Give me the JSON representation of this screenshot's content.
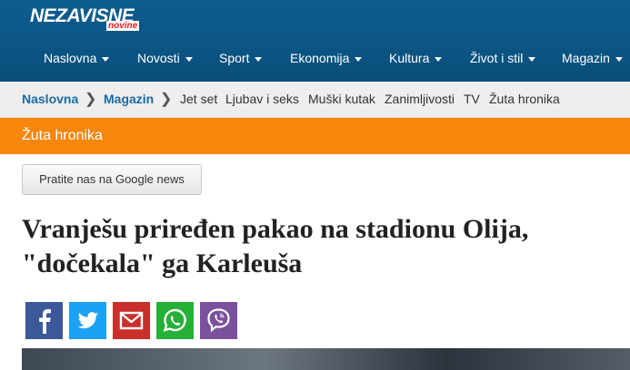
{
  "site": {
    "logo_main": "NEZAVISNE",
    "logo_sub": "novine"
  },
  "nav": [
    {
      "label": "Naslovna"
    },
    {
      "label": "Novosti"
    },
    {
      "label": "Sport"
    },
    {
      "label": "Ekonomija"
    },
    {
      "label": "Kultura"
    },
    {
      "label": "Život i stil"
    },
    {
      "label": "Magazin"
    }
  ],
  "breadcrumb": [
    {
      "label": "Naslovna"
    },
    {
      "label": "Magazin"
    }
  ],
  "subnav": [
    {
      "label": "Jet set"
    },
    {
      "label": "Ljubav i seks"
    },
    {
      "label": "Muški kutak"
    },
    {
      "label": "Zanimljivosti"
    },
    {
      "label": "TV"
    },
    {
      "label": "Žuta hronika"
    }
  ],
  "category": {
    "label": "Žuta hronika"
  },
  "google_news": {
    "label": "Pratite nas na Google news"
  },
  "article": {
    "headline": "Vranješu priređen pakao na stadionu Olija, \"dočekala\" ga Karleuša"
  },
  "share": [
    {
      "icon": "facebook-icon",
      "color": "#3b5998"
    },
    {
      "icon": "twitter-icon",
      "color": "#1da1f2"
    },
    {
      "icon": "gmail-icon",
      "color": "#c9302c"
    },
    {
      "icon": "whatsapp-icon",
      "color": "#25b038"
    },
    {
      "icon": "viber-icon",
      "color": "#7b519d"
    }
  ],
  "colors": {
    "header": "#0d5d8f",
    "category_bar": "#f7860c",
    "breadcrumb_link": "#1a6aa3"
  }
}
